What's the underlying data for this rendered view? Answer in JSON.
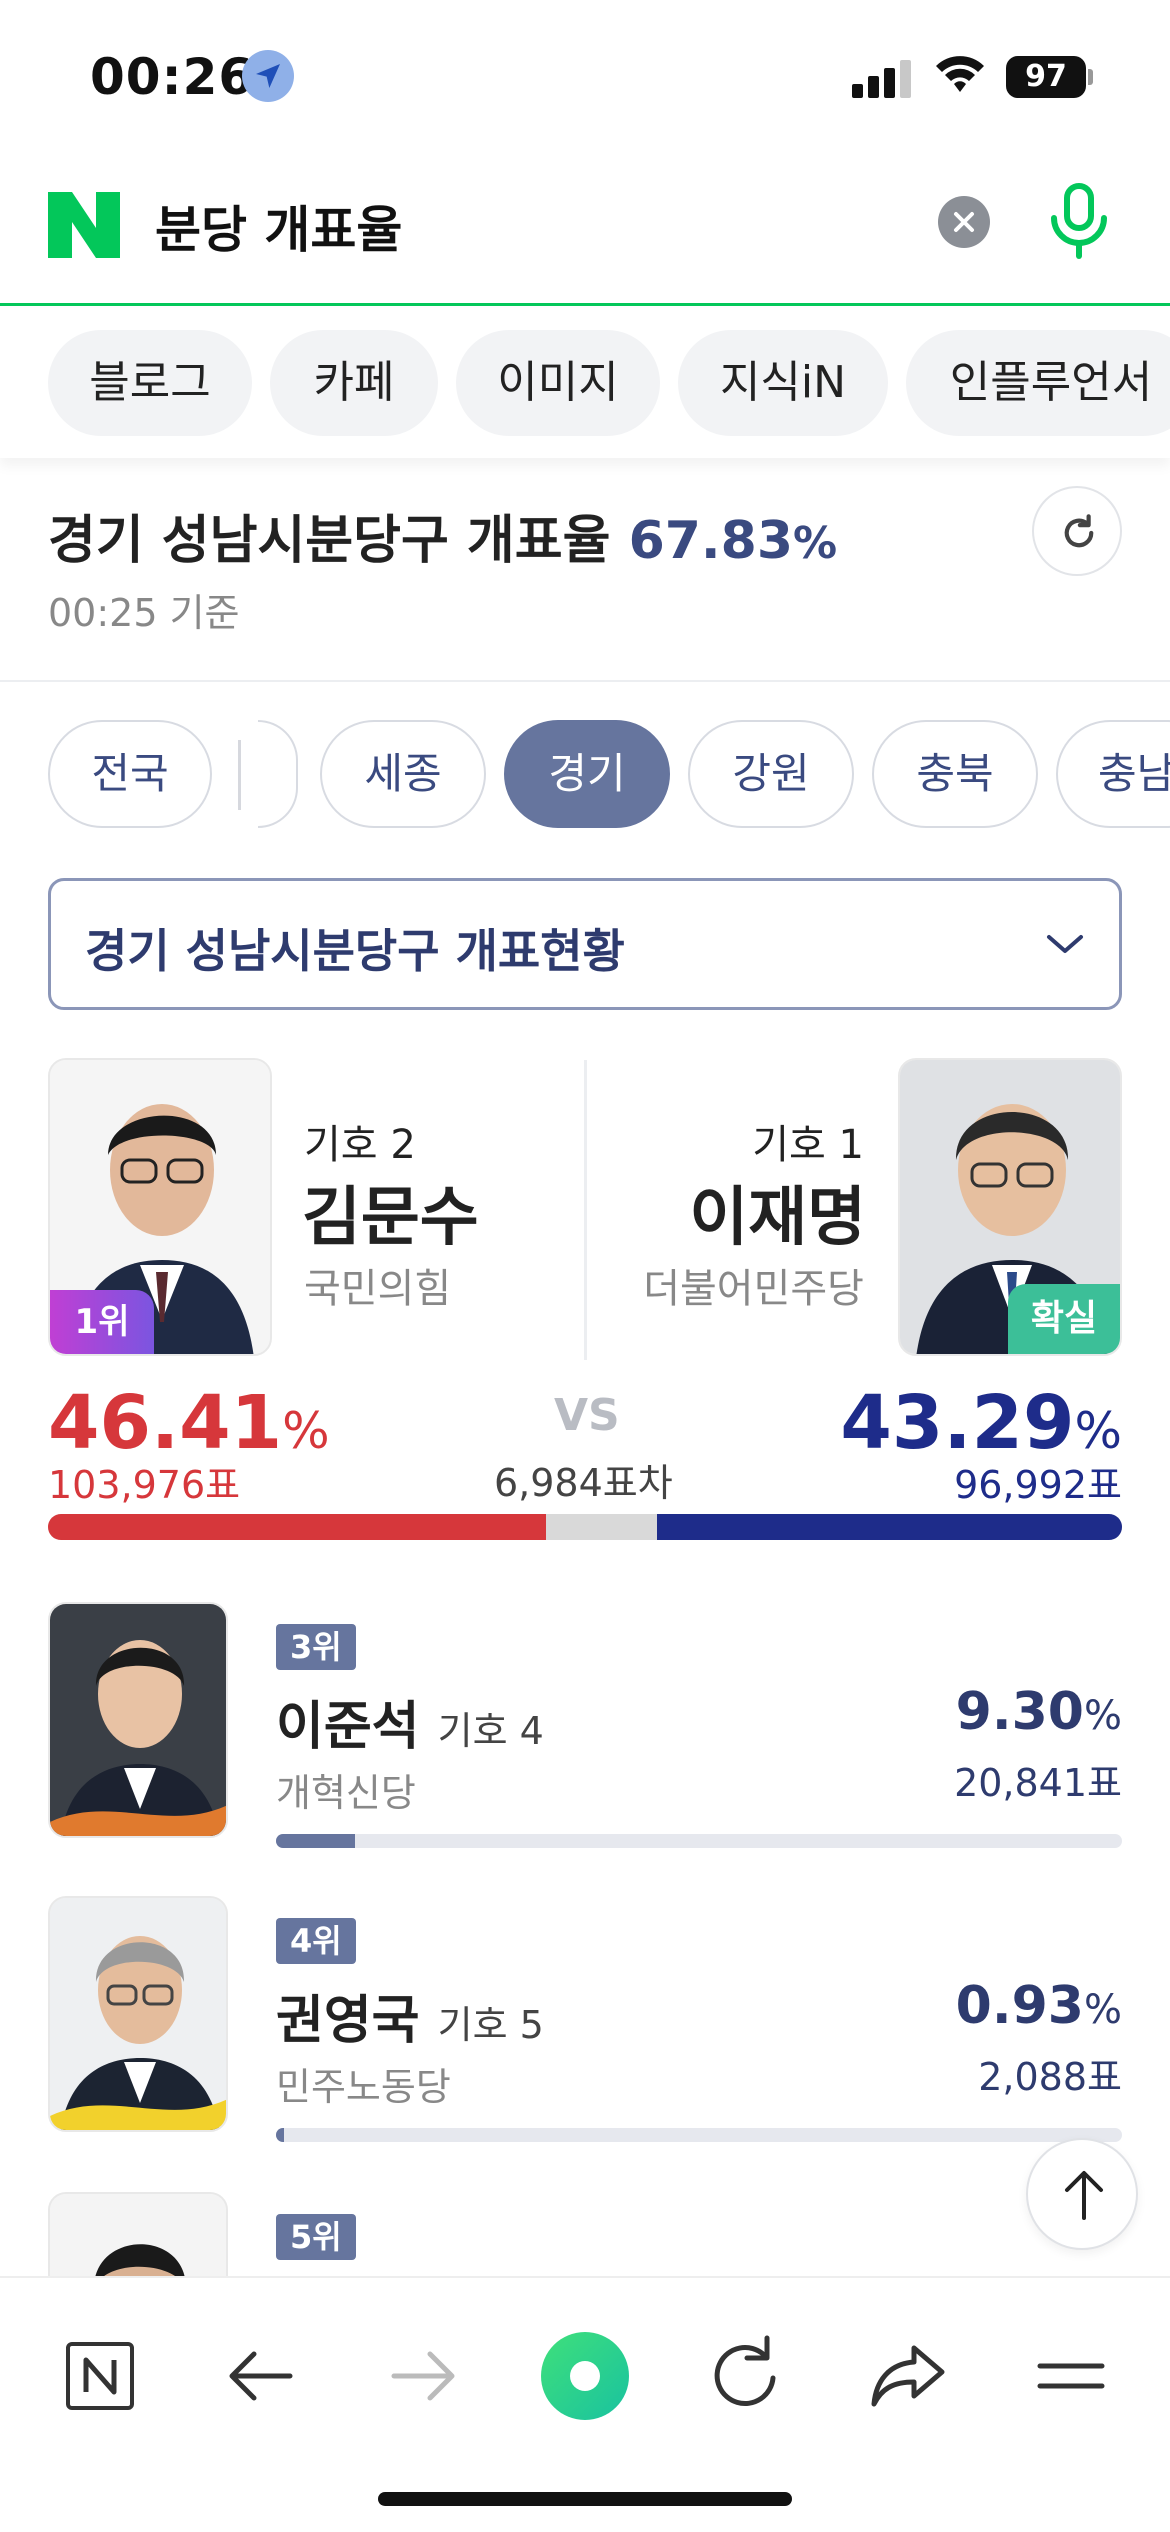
{
  "status_bar": {
    "time": "00:26",
    "battery": "97"
  },
  "search": {
    "query": "분당 개표율"
  },
  "tabs": [
    "블로그",
    "카페",
    "이미지",
    "지식iN",
    "인플루언서"
  ],
  "election": {
    "title_prefix": "경기 성남시분당구 개표율",
    "rate_value": "67.83",
    "rate_unit": "%",
    "timestamp": "00:25 기준"
  },
  "regions": [
    "전국",
    "세종",
    "경기",
    "강원",
    "충북",
    "충남"
  ],
  "active_region": "경기",
  "dropdown": {
    "label": "경기 성남시분당구 개표현황"
  },
  "main_race": {
    "left": {
      "number": "기호 2",
      "name": "김문수",
      "party": "국민의힘",
      "badge": "1위",
      "pct": "46.41",
      "pct_unit": "%",
      "votes": "103,976표",
      "share": 0.4641
    },
    "right": {
      "number": "기호 1",
      "name": "이재명",
      "party": "더불어민주당",
      "badge": "확실",
      "pct": "43.29",
      "pct_unit": "%",
      "votes": "96,992표",
      "share": 0.4329
    },
    "vs": "VS",
    "gap": "6,984표차"
  },
  "others": [
    {
      "rank": "3위",
      "name": "이준석",
      "number": "기호 4",
      "party": "개혁신당",
      "pct": "9.30",
      "pct_unit": "%",
      "votes": "20,841표",
      "share": 0.093
    },
    {
      "rank": "4위",
      "name": "권영국",
      "number": "기호 5",
      "party": "민주노동당",
      "pct": "0.93",
      "pct_unit": "%",
      "votes": "2,088표",
      "share": 0.0093
    },
    {
      "rank": "5위"
    }
  ],
  "colors": {
    "naver_green": "#03c75a",
    "red": "#d6373b",
    "blue": "#1e2c8a",
    "navy": "#2e3b6e",
    "slate": "#66759e"
  }
}
